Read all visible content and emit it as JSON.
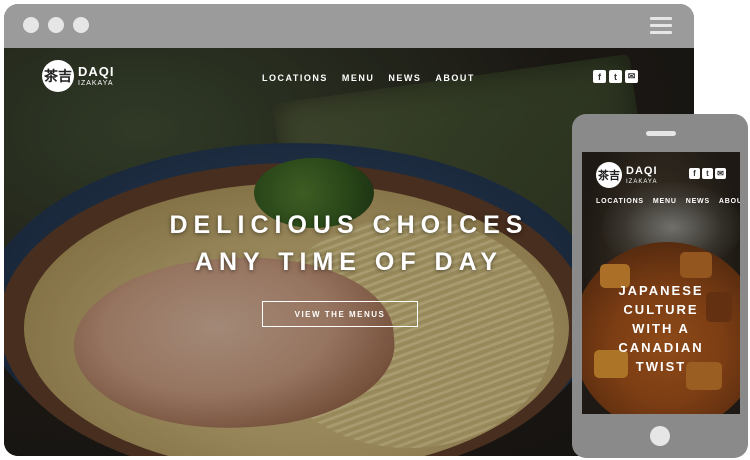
{
  "browser": {
    "window_dots": [
      "close",
      "minimize",
      "maximize"
    ],
    "menu_icon": "hamburger-icon"
  },
  "site": {
    "logo_mark": "茶吉",
    "logo_name": "DAQI",
    "logo_sub": "IZAKAYA",
    "nav": [
      "LOCATIONS",
      "MENU",
      "NEWS",
      "ABOUT"
    ],
    "social_icons": [
      {
        "icon": "facebook-icon",
        "glyph": "f"
      },
      {
        "icon": "twitter-icon",
        "glyph": "t"
      },
      {
        "icon": "email-icon",
        "glyph": "✉"
      }
    ]
  },
  "desktop": {
    "headline_line1": "DELICIOUS CHOICES",
    "headline_line2": "ANY TIME OF DAY",
    "cta_label": "VIEW THE MENUS"
  },
  "mobile": {
    "headline_lines": [
      "JAPANESE",
      "CULTURE",
      "WITH A",
      "CANADIAN",
      "TWIST"
    ]
  },
  "colors": {
    "frame": "#8a8a8a",
    "frame_controls": "#e6e6e6",
    "text": "#ffffff"
  }
}
